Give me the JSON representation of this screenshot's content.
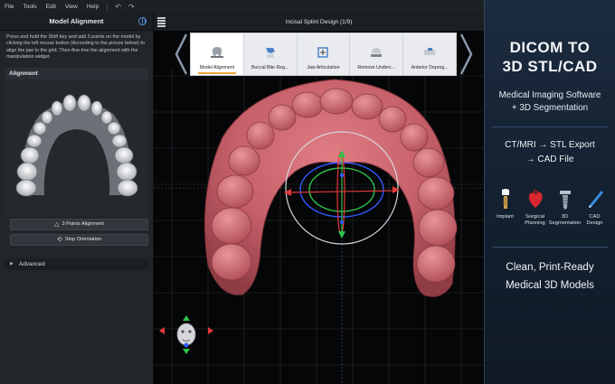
{
  "menubar": {
    "items": [
      "File",
      "Tools",
      "Edit",
      "View",
      "Help"
    ],
    "undo_icon": "undo-icon",
    "redo_icon": "redo-icon"
  },
  "left_panel": {
    "title": "Model Alignment",
    "hint": "Press and hold the Shift key and add 3 points on the model by clicking the left mouse button (According to the picture below) to align the jaw to the grid. Then-fine-tine the alignment with the manipulation widget.",
    "section_alignment": "Alignment",
    "btn_three_points": "3 Points Alignment",
    "btn_stop": "Stop Orientation",
    "section_advanced": "Advanced"
  },
  "viewport": {
    "title": "Incisal Splint Design (1/9)",
    "steps": [
      {
        "label": "Model Alignment",
        "icon": "tooth-icon",
        "active": true
      },
      {
        "label": "Buccal Bite Reg...",
        "icon": "bite-icon",
        "active": false
      },
      {
        "label": "Jaw Articulation",
        "icon": "articulation-icon",
        "active": false
      },
      {
        "label": "Remove Underc...",
        "icon": "undercut-icon",
        "active": false
      },
      {
        "label": "Anterior Deprog...",
        "icon": "deprogrammer-icon",
        "active": false
      }
    ]
  },
  "ad": {
    "headline_line1": "DICOM TO",
    "headline_line2": "3D STL/CAD",
    "sub_line1": "Medical Imaging Software",
    "sub_line2": "+ 3D Segmentation",
    "flow_line1": "CT/MRI → STL Export",
    "flow_line2": "→ CAD File",
    "icons": [
      {
        "label": "Implant",
        "icon": "implant-icon"
      },
      {
        "label": "Surgical Planning",
        "icon": "heart-icon"
      },
      {
        "label": "3D Segmentation",
        "icon": "screw-icon"
      },
      {
        "label": "CAD Design",
        "icon": "pen-icon"
      }
    ],
    "foot_line1": "Clean, Print-Ready",
    "foot_line2": "Medical 3D Models"
  },
  "colors": {
    "model": "#c8656b",
    "accent": "#f2a33a",
    "axis_red": "#e23a3a",
    "axis_green": "#2ec44a",
    "axis_blue": "#2f5bff"
  }
}
